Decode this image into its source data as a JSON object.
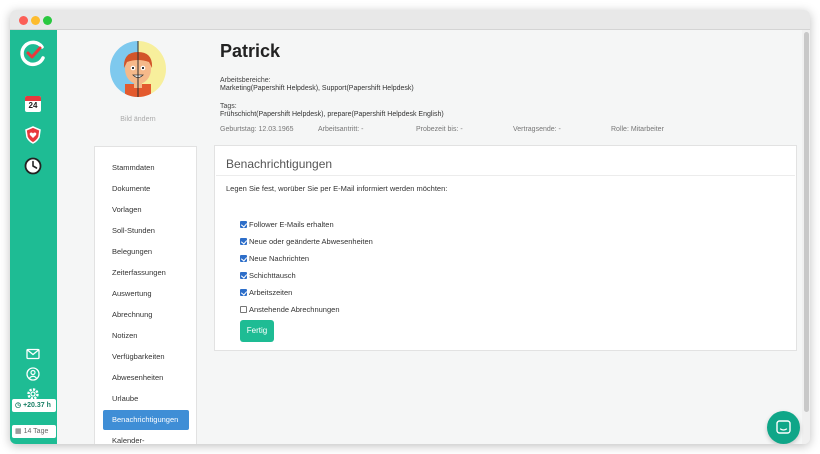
{
  "profile": {
    "name": "Patrick",
    "change_picture": "Bild ändern",
    "areas_label": "Arbeitsbereiche:",
    "areas_value": "Marketing(Papershift Helpdesk), Support(Papershift Helpdesk)",
    "tags_label": "Tags:",
    "tags_value": "Frühschicht(Papershift Helpdesk), prepare(Papershift Helpdesk English)",
    "meta": {
      "birthday": "Geburtstag: 12.03.1965",
      "start": "Arbeitsantritt: -",
      "probation": "Probezeit bis: -",
      "contract_end": "Vertragsende: -",
      "role": "Rolle: Mitarbeiter"
    }
  },
  "sidebar": {
    "calendar_day": "24",
    "overtime_badge": "+20.37 h",
    "days_badge": "14 Tage",
    "icons": [
      "logo-icon",
      "calendar-icon",
      "shield-heart-icon",
      "clock-icon",
      "mail-icon",
      "user-icon",
      "gear-icon"
    ]
  },
  "menu": {
    "items": [
      {
        "label": "Stammdaten"
      },
      {
        "label": "Dokumente"
      },
      {
        "label": "Vorlagen"
      },
      {
        "label": "Soll-Stunden"
      },
      {
        "label": "Belegungen"
      },
      {
        "label": "Zeiterfassungen"
      },
      {
        "label": "Auswertung"
      },
      {
        "label": "Abrechnung"
      },
      {
        "label": "Notizen"
      },
      {
        "label": "Verfügbarkeiten"
      },
      {
        "label": "Abwesenheiten"
      },
      {
        "label": "Urlaube"
      },
      {
        "label": "Benachrichtigungen"
      },
      {
        "label": "Kalender-Synchronisierung"
      }
    ],
    "active_index": 12
  },
  "notifications": {
    "title": "Benachrichtigungen",
    "description": "Legen Sie fest, worüber Sie per E-Mail informiert werden möchten:",
    "options": [
      {
        "label": "Follower E-Mails erhalten",
        "checked": true
      },
      {
        "label": "Neue oder geänderte Abwesenheiten",
        "checked": true
      },
      {
        "label": "Neue Nachrichten",
        "checked": true
      },
      {
        "label": "Schichttausch",
        "checked": true
      },
      {
        "label": "Arbeitszeiten",
        "checked": true
      },
      {
        "label": "Anstehende Abrechnungen",
        "checked": false
      }
    ],
    "done_label": "Fertig"
  },
  "colors": {
    "sidebar": "#1ebc94",
    "active_menu": "#3f8ed6",
    "button": "#1ebc94",
    "chat": "#0fa688"
  }
}
